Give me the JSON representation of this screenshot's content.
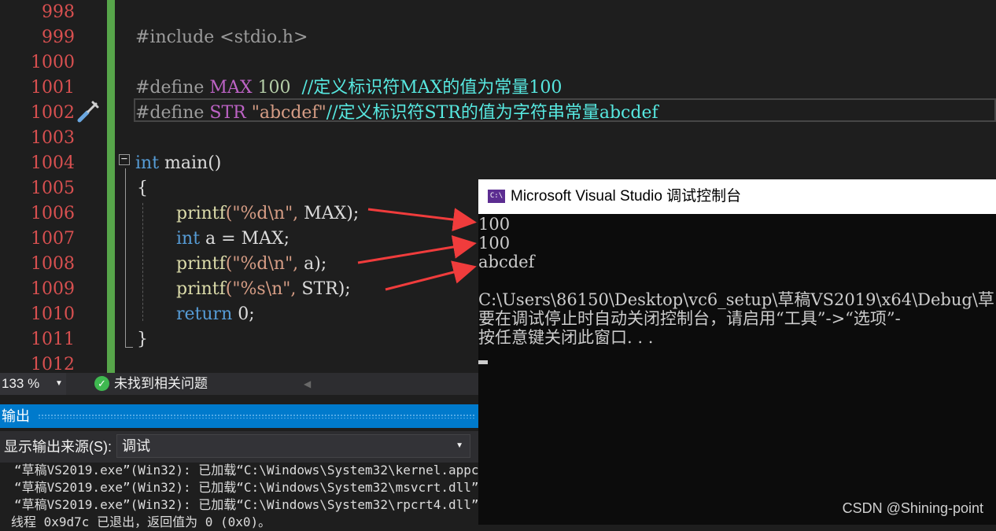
{
  "editor": {
    "line_numbers": [
      "998",
      "999",
      "1000",
      "1001",
      "1002",
      "1003",
      "1004",
      "1005",
      "1006",
      "1007",
      "1008",
      "1009",
      "1010",
      "1011",
      "1012"
    ],
    "lines": [
      {
        "text": ""
      },
      {
        "text": "#include <stdio.h>"
      },
      {
        "text": ""
      },
      {
        "pre": "#define ",
        "name": "MAX",
        "mid": " 100  ",
        "comment": "//定义标识符MAX的值为常量100"
      },
      {
        "pre": "#define ",
        "name": "STR",
        "mid": " \"abcdef\"",
        "comment": "//定义标识符STR的值为字符串常量abcdef"
      },
      {
        "text": ""
      },
      {
        "kw": "int",
        "rest": " main()"
      },
      {
        "text": "{"
      },
      {
        "fn": "printf",
        "str": "(\"%d\\n\",",
        "arg": " MAX);"
      },
      {
        "kw": "int",
        "rest": " a = MAX;"
      },
      {
        "fn": "printf",
        "str": "(\"%d\\n\",",
        "arg": " a);"
      },
      {
        "fn": "printf",
        "str": "(\"%s\\n\",",
        "arg": " STR);"
      },
      {
        "kw": "return",
        "rest": " 0;"
      },
      {
        "text": "}"
      },
      {
        "text": ""
      }
    ]
  },
  "status": {
    "zoom": "133 %",
    "issues": "未找到相关问题"
  },
  "output": {
    "title": "输出",
    "source_label": "显示输出来源(S):",
    "source_value": "调试",
    "lines": [
      "“草稿VS2019.exe”(Win32): 已加载“C:\\Windows\\System32\\kernel.appc",
      "“草稿VS2019.exe”(Win32): 已加载“C:\\Windows\\System32\\msvcrt.dll”",
      "“草稿VS2019.exe”(Win32): 已加载“C:\\Windows\\System32\\rpcrt4.dll”",
      "线程 0x9d7c 已退出，返回值为 0 (0x0)。"
    ]
  },
  "console": {
    "title": "Microsoft Visual Studio 调试控制台",
    "icon": "C:\\",
    "lines": [
      "100",
      "100",
      "abcdef",
      "",
      "C:\\Users\\86150\\Desktop\\vc6_setup\\草稿VS2019\\x64\\Debug\\草",
      "要在调试停止时自动关闭控制台，请启用“工具”->“选项”-",
      "按任意键关闭此窗口. . ."
    ]
  },
  "watermark": "CSDN @Shining-point",
  "colors": {
    "line_number": "#d85050",
    "arrow": "#f03c3c",
    "accent": "#007acc"
  }
}
